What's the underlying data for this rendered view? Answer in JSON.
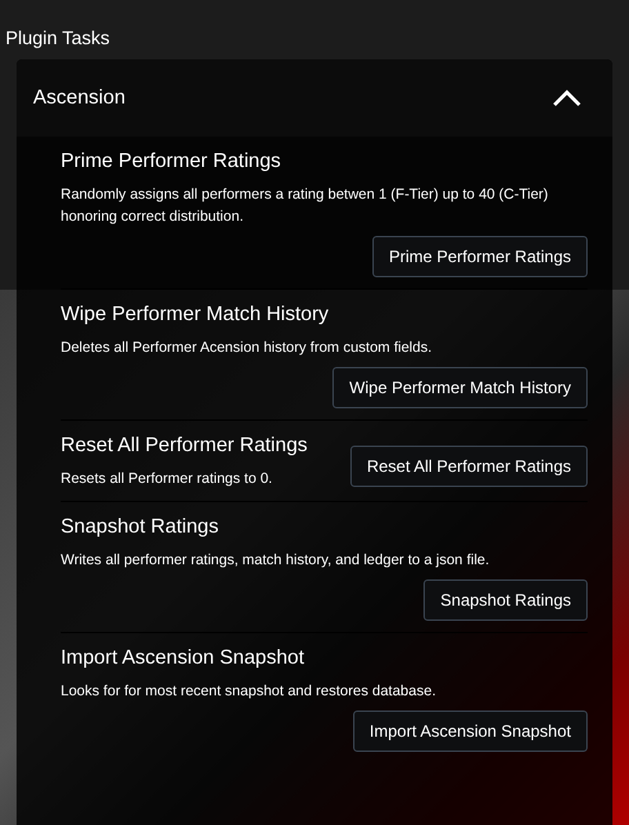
{
  "title": "Plugin Tasks",
  "section": {
    "title": "Ascension",
    "expanded": true,
    "tasks": [
      {
        "name": "Prime Performer Ratings",
        "description": "Randomly assigns all performers a rating betwen 1 (F-Tier) up to 40 (C-Tier) honoring correct distribution.",
        "button": "Prime Performer Ratings"
      },
      {
        "name": "Wipe Performer Match History",
        "description": "Deletes all Performer Acension history from custom fields.",
        "button": "Wipe Performer Match History"
      },
      {
        "name": "Reset All Performer Ratings",
        "description": "Resets all Performer ratings to 0.",
        "button": "Reset All Performer Ratings"
      },
      {
        "name": "Snapshot Ratings",
        "description": "Writes all performer ratings, match history, and ledger to a json file.",
        "button": "Snapshot Ratings"
      },
      {
        "name": "Import Ascension Snapshot",
        "description": "Looks for for most recent snapshot and restores database.",
        "button": "Import Ascension Snapshot"
      }
    ]
  }
}
